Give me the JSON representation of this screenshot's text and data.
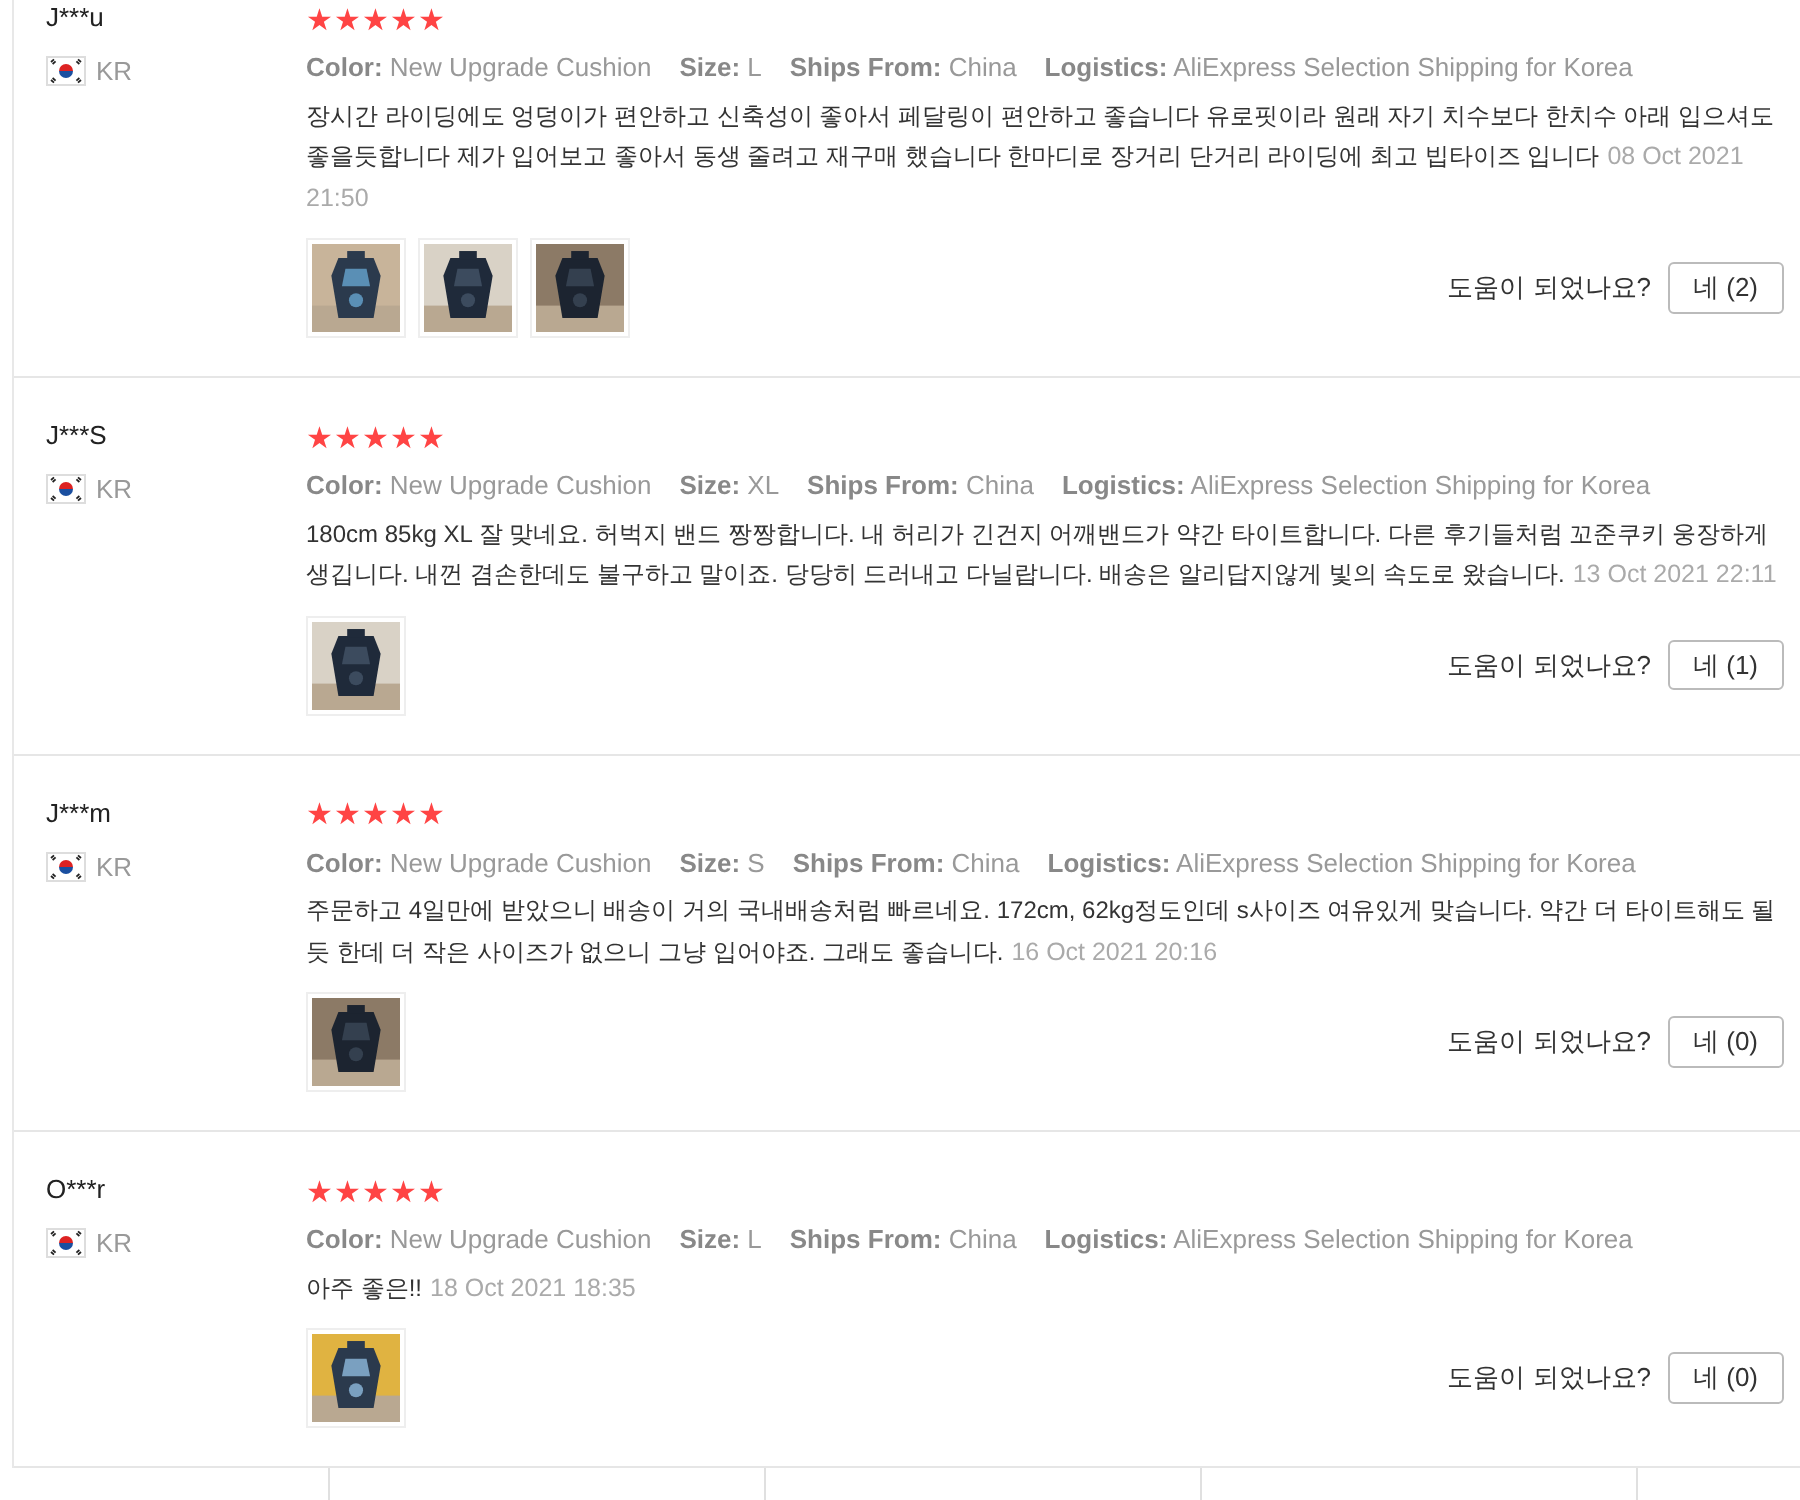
{
  "reviews": [
    {
      "user": "J***u",
      "country": "KR",
      "stars": 5,
      "attributes": [
        {
          "label": "Color:",
          "value": "New Upgrade Cushion"
        },
        {
          "label": "Size:",
          "value": "L"
        },
        {
          "label": "Ships From:",
          "value": "China"
        },
        {
          "label": "Logistics:",
          "value": "AliExpress Selection Shipping for Korea"
        }
      ],
      "text": "장시간 라이딩에도 엉덩이가 편안하고 신축성이 좋아서 페달링이 편안하고 좋습니다 유로핏이라 원래 자기 치수보다 한치수 아래 입으셔도 좋을듯합니다 제가 입어보고 좋아서 동생 줄려고 재구매 했습니다 한마디로 장거리 단거리 라이딩에 최고 빕타이즈 입니다",
      "date": "08 Oct 2021 21:50",
      "photos": [
        {
          "kind": "picture"
        },
        {
          "kind": "picture"
        },
        {
          "kind": "picture"
        }
      ],
      "helpful_label": "도움이 되었나요?",
      "helpful_button": "네 (2)"
    },
    {
      "user": "J***S",
      "country": "KR",
      "stars": 5,
      "attributes": [
        {
          "label": "Color:",
          "value": "New Upgrade Cushion"
        },
        {
          "label": "Size:",
          "value": "XL"
        },
        {
          "label": "Ships From:",
          "value": "China"
        },
        {
          "label": "Logistics:",
          "value": "AliExpress Selection Shipping for Korea"
        }
      ],
      "text": "180cm 85kg XL 잘 맞네요. 허벅지 밴드 짱짱합니다. 내 허리가 긴건지 어깨밴드가 약간 타이트합니다. 다른 후기들처럼 꼬준쿠키 웅장하게 생깁니다. 내껀 겸손한데도 불구하고 말이죠. 당당히 드러내고 다닐랍니다. 배송은 알리답지않게 빛의 속도로 왔습니다.",
      "date": "13 Oct 2021 22:11",
      "photos": [
        {
          "kind": "picture"
        }
      ],
      "helpful_label": "도움이 되었나요?",
      "helpful_button": "네 (1)"
    },
    {
      "user": "J***m",
      "country": "KR",
      "stars": 5,
      "attributes": [
        {
          "label": "Color:",
          "value": "New Upgrade Cushion"
        },
        {
          "label": "Size:",
          "value": "S"
        },
        {
          "label": "Ships From:",
          "value": "China"
        },
        {
          "label": "Logistics:",
          "value": "AliExpress Selection Shipping for Korea"
        }
      ],
      "text": "주문하고 4일만에 받았으니 배송이 거의 국내배송처럼 빠르네요. 172cm, 62kg정도인데 s사이즈 여유있게 맞습니다. 약간 더 타이트해도 될 듯 한데 더 작은 사이즈가 없으니 그냥 입어야죠. 그래도 좋습니다.",
      "date": "16 Oct 2021 20:16",
      "photos": [
        {
          "kind": "picture"
        }
      ],
      "helpful_label": "도움이 되었나요?",
      "helpful_button": "네 (0)"
    },
    {
      "user": "O***r",
      "country": "KR",
      "stars": 5,
      "attributes": [
        {
          "label": "Color:",
          "value": "New Upgrade Cushion"
        },
        {
          "label": "Size:",
          "value": "L"
        },
        {
          "label": "Ships From:",
          "value": "China"
        },
        {
          "label": "Logistics:",
          "value": "AliExpress Selection Shipping for Korea"
        }
      ],
      "text": "아주 좋은!!",
      "date": "18 Oct 2021 18:35",
      "photos": [
        {
          "kind": "picture"
        }
      ],
      "helpful_label": "도움이 되었나요?",
      "helpful_button": "네 (0)"
    }
  ]
}
